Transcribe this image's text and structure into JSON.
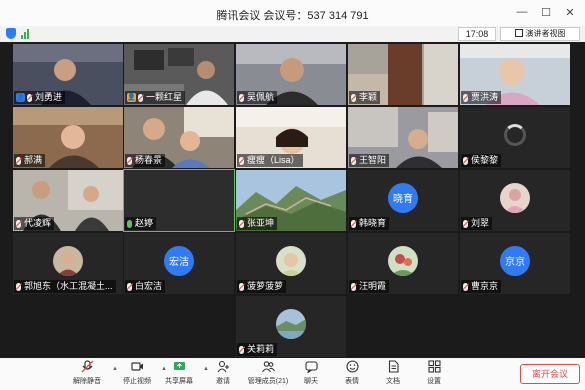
{
  "window": {
    "title": "腾讯会议  会议号：537 314 791"
  },
  "subbar": {
    "timer": "17:08",
    "speaker_view": "演讲者视图"
  },
  "tiles": [
    {
      "name": "刘勇进",
      "host": "blue"
    },
    {
      "name": "一颗红星",
      "host": "orange"
    },
    {
      "name": "吴佩航"
    },
    {
      "name": "李颖"
    },
    {
      "name": "贾洪涛"
    },
    {
      "name": "郝满"
    },
    {
      "name": "杨春景"
    },
    {
      "name": "瘦瘦（Lisa）"
    },
    {
      "name": "王智阳"
    },
    {
      "name": "侯黎黎"
    },
    {
      "name": "代凌辉"
    },
    {
      "name": "赵婷",
      "avatar_text": ""
    },
    {
      "name": "张亚坤"
    },
    {
      "name": "韩晓育",
      "avatar_text": "晓育",
      "avatar_color": "#2f7bf5"
    },
    {
      "name": "刘翠"
    },
    {
      "name": "郭旭东（水工混凝土..."
    },
    {
      "name": "白宏洁",
      "avatar_text": "宏洁",
      "avatar_color": "#2f7bf5"
    },
    {
      "name": "菠萝菠萝"
    },
    {
      "name": "汪明霞"
    },
    {
      "name": "曹京京",
      "avatar_text": "京京",
      "avatar_color": "#2f7bf5"
    },
    {
      "name": "关莉莉"
    }
  ],
  "toolbar": {
    "items": [
      {
        "label": "解除静音",
        "icon": "mic-muted-icon"
      },
      {
        "label": "停止视频",
        "icon": "video-icon"
      },
      {
        "label": "共享屏幕",
        "icon": "share-screen-icon"
      },
      {
        "label": "邀请",
        "icon": "invite-icon"
      },
      {
        "label": "管理成员(21)",
        "icon": "members-icon"
      },
      {
        "label": "聊天",
        "icon": "chat-icon"
      },
      {
        "label": "表情",
        "icon": "emoji-icon"
      },
      {
        "label": "文档",
        "icon": "document-icon"
      },
      {
        "label": "设置",
        "icon": "settings-icon"
      }
    ],
    "end_label": "离开会议"
  },
  "colors": {
    "accent": "#2f7bf5",
    "end": "#e14b4b",
    "active_border": "#59c35c"
  }
}
